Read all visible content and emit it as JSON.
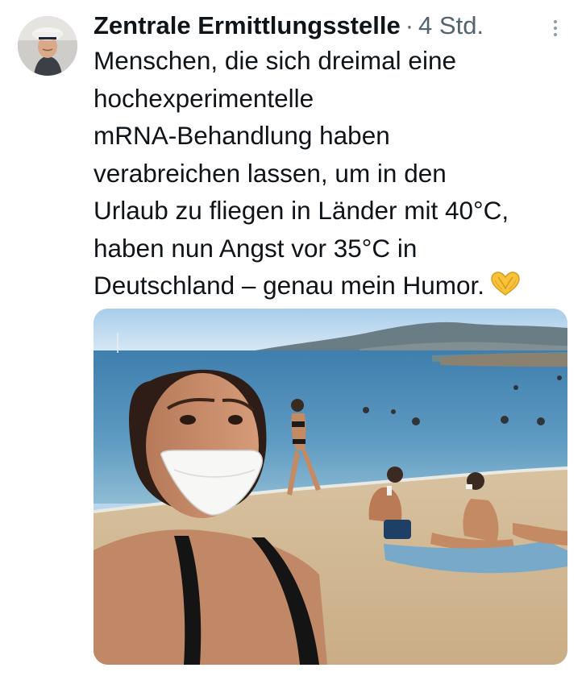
{
  "tweet": {
    "author": {
      "display_name": "Zentrale Ermittlungsstelle",
      "avatar_icon": "sailor-cap-portrait"
    },
    "separator": "·",
    "timestamp": "4 Std.",
    "more_icon": "vertical-ellipsis-icon",
    "text": "Menschen, die sich dreimal eine\nhochexperimentelle\nmRNA-Behandlung haben\nverabreichen lassen, um in den\nUrlaub zu fliegen in Länder mit 40°C,\nhaben nun Angst vor 35°C in\nDeutschland – genau mein Humor.",
    "emoji": "heart-hands-emoji",
    "media": {
      "type": "photo",
      "subject": "woman-with-ffp2-mask-beach-selfie"
    }
  },
  "colors": {
    "text_primary": "#0f1419",
    "text_secondary": "#536471",
    "emoji_yellow": "#f6c33b"
  }
}
